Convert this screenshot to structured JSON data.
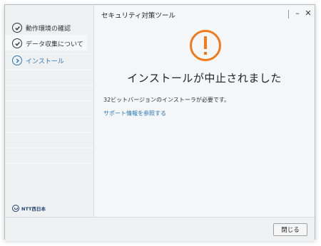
{
  "window": {
    "title": "セキュリティ対策ツール",
    "minimize_glyph": "–",
    "close_glyph": "✕"
  },
  "sidebar": {
    "steps": [
      {
        "label": "動作環境の確認",
        "state": "done",
        "icon": "check-icon"
      },
      {
        "label": "データ収集について",
        "state": "done",
        "icon": "check-icon"
      },
      {
        "label": "インストール",
        "state": "current",
        "icon": "chevron-right-icon"
      }
    ],
    "logo_text": "NTT西日本"
  },
  "main": {
    "status_icon": "warning-icon",
    "headline": "インストールが中止されました",
    "message": "32ビットバージョンのインストーラが必要です。",
    "support_link": "サポート情報を参照する"
  },
  "footer": {
    "close_label": "閉じる"
  },
  "colors": {
    "accent": "#2a78b8",
    "warning": "#f07b1c",
    "brand": "#1f3f73"
  }
}
